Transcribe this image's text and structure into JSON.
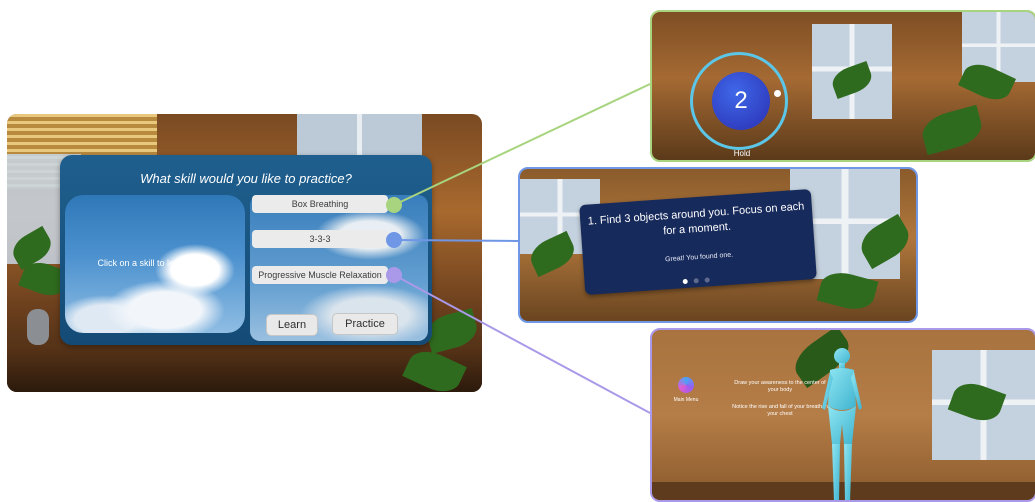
{
  "main_panel": {
    "title": "What skill would you like to practice?",
    "image_caption": "Click on a skill to learn more.",
    "skills": [
      {
        "label": "Box Breathing"
      },
      {
        "label": "3-3-3"
      },
      {
        "label": "Progressive Muscle Relaxation"
      }
    ],
    "learn_label": "Learn",
    "practice_label": "Practice"
  },
  "box_breathing_preview": {
    "count": "2",
    "phase": "Hold"
  },
  "three_three_three_preview": {
    "prompt": "1. Find 3 objects around you. Focus on each for a moment.",
    "feedback": "Great! You found one.",
    "steps_total": 3,
    "step_current": 1
  },
  "pmr_preview": {
    "menu_label": "Main Menu",
    "instruction_1": "Draw your awareness to the center of your body",
    "instruction_2": "Notice the rise and fall of your breath in your chest"
  },
  "colors": {
    "connector_box": "#a8d47f",
    "connector_333": "#6f97e6",
    "connector_pmr": "#a999e8",
    "panel_blue": "#1a5686",
    "card_navy": "#172a5c"
  }
}
